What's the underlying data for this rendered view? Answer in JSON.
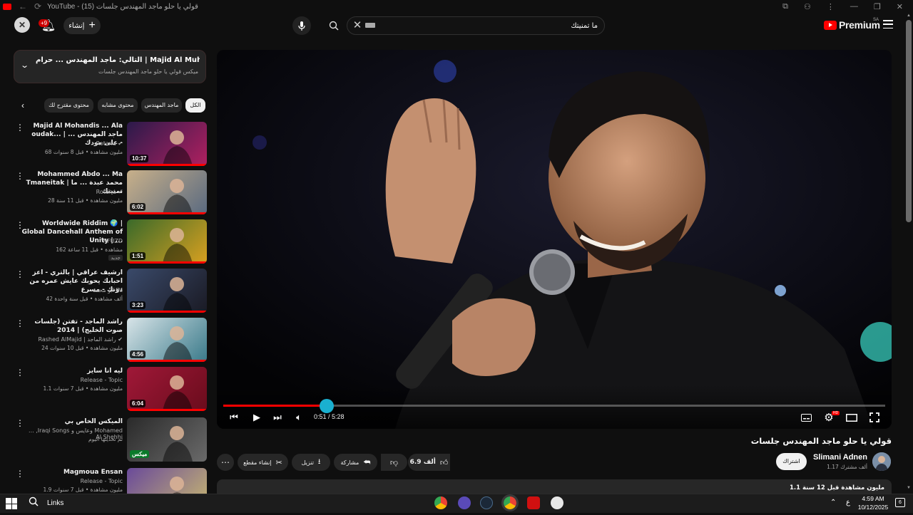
{
  "window": {
    "title": "YouTube - قولي يا حلو ماجد المهندس جلسات (15)",
    "controls": [
      "—",
      "❐",
      "✕"
    ]
  },
  "header": {
    "account_initial": "✕",
    "notif_count": "+9",
    "create_label": "إنشاء",
    "search_value": "ما تمنيتك",
    "logo_text": "Premium",
    "logo_region": "SA"
  },
  "up_next": {
    "title": "التالي: ماجد المهندس ... حرام | Majid Al Muhandis ... Haram",
    "subtitle": "ميكس قولي يا حلو ماجد المهندس جلسات"
  },
  "chips": [
    "الكل",
    "ماجد المهندس",
    "محتوى مشابه",
    "محتوى مقترح لك"
  ],
  "related": [
    {
      "title": "Majid Al Mohandis ... Ala oudak... | ماجد المهندس ... على مودك -",
      "channel": "Rotana",
      "verified": true,
      "meta": "68 مليون مشاهدة • قبل 8 سنوات",
      "duration": "10:37",
      "badge": "",
      "colors": [
        "#2a1a4a",
        "#b02060"
      ]
    },
    {
      "title": "Mohammed Abdo ... Ma Tmaneitak | محمد عبدة ... ما تمنيتك",
      "channel": "Rotana",
      "verified": true,
      "meta": "28 مليون مشاهدة • قبل 11 سنة",
      "duration": "6:02",
      "badge": "",
      "colors": [
        "#c8b08a",
        "#5a6a80"
      ]
    },
    {
      "title": "Worldwide Riddim 🌍 | Global Dancehall Anthem of Unity | ...",
      "channel": "NFUZD",
      "verified": false,
      "meta": "162 مشاهدة • قبل 11 ساعة",
      "duration": "1:51",
      "badge": "جديد",
      "colors": [
        "#3a6a2a",
        "#d8a020"
      ]
    },
    {
      "title": "ارشيف عراقي | بالتري - اعز احبابك يحوبك عايش عمره من دونك - مسرع",
      "channel": "ابو محمد fM",
      "verified": false,
      "meta": "42 ألف مشاهدة • قبل سنة واحدة",
      "duration": "3:23",
      "badge": "",
      "colors": [
        "#3a4a6a",
        "#1a1a24"
      ]
    },
    {
      "title": "راشد الماجد - تفتن (جلسات صوت الخليج) | 2014",
      "channel": "Rashed AlMajid | راشد الماجد",
      "verified": true,
      "meta": "24 مليون مشاهدة • قبل 10 سنوات",
      "duration": "4:56",
      "badge": "",
      "colors": [
        "#d8e4e8",
        "#3a7a8a"
      ]
    },
    {
      "title": "ليه انا سايز",
      "channel": "Release - Topic",
      "verified": false,
      "meta": "1.1 مليون مشاهدة • قبل 7 سنوات",
      "duration": "6:04",
      "badge": "",
      "colors": [
        "#a01838",
        "#6a0c1c"
      ]
    },
    {
      "title": "الميكس الخاص بي",
      "channel": "... ,Iraqi Songs وعايس و Mohamed Al Shehhi",
      "verified": false,
      "meta": "تم تحديثها اليوم",
      "duration": "",
      "badge": "ميكس",
      "colors": [
        "#2a2a2a",
        "#6a6a6a"
      ]
    },
    {
      "title": "Magmoua Ensan",
      "channel": "Release - Topic",
      "verified": false,
      "meta": "1.9 مليون مشاهدة • قبل 7 سنوات",
      "duration": "",
      "badge": "",
      "colors": [
        "#6a4a9a",
        "#c8b870"
      ]
    }
  ],
  "player": {
    "time": "0:51 / 5:28",
    "progress_fraction": 0.156,
    "hd_label": "HD"
  },
  "video": {
    "title": "قولي يا حلو ماجد المهندس جلسات",
    "channel": "Slimani Adnen",
    "subscribers": "1.17 ألف مشترك",
    "subscribe_label": "اشتراك",
    "likes": "6.9 ألف",
    "share_label": "مشاركة",
    "download_label": "تنزيل",
    "clip_label": "إنشاء مقطع",
    "stats": "1.1 مليون مشاهدة  قبل 12 سنة"
  },
  "taskbar": {
    "search_label": "Links",
    "lang": "ع",
    "time": "4:59 AM",
    "date": "10/12/2025",
    "notif_count": "6"
  }
}
